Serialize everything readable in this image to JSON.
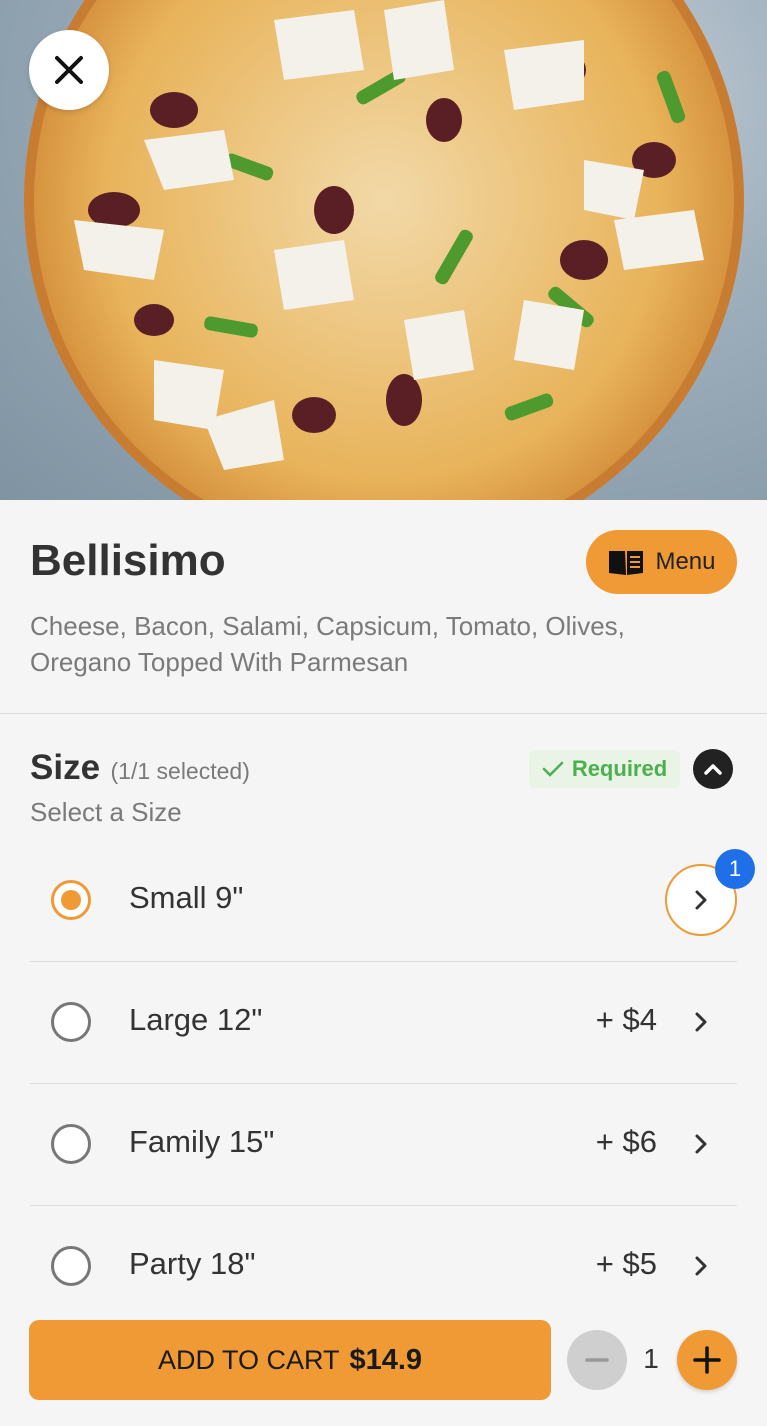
{
  "product": {
    "name": "Bellisimo",
    "description": "Cheese, Bacon, Salami, Capsicum, Tomato, Olives, Oregano Topped With Parmesan",
    "image_alt": "pizza-photo"
  },
  "header": {
    "close_icon": "close-icon",
    "menu_label": "Menu",
    "menu_icon": "book-icon"
  },
  "size_group": {
    "title": "Size",
    "count": "(1/1 selected)",
    "subtitle": "Select a Size",
    "required_label": "Required",
    "options": [
      {
        "label": "Small 9\"",
        "price": "",
        "selected": true,
        "badge": "1"
      },
      {
        "label": "Large 12\"",
        "price": "+ $4",
        "selected": false
      },
      {
        "label": "Family 15\"",
        "price": "+ $6",
        "selected": false
      },
      {
        "label": "Party 18\"",
        "price": "+ $5",
        "selected": false
      }
    ]
  },
  "cart": {
    "add_label": "ADD TO CART",
    "price": "$14.9",
    "quantity": "1"
  },
  "colors": {
    "accent": "#ef9a35",
    "badge": "#1e6fe8",
    "required": "#4caf50"
  }
}
